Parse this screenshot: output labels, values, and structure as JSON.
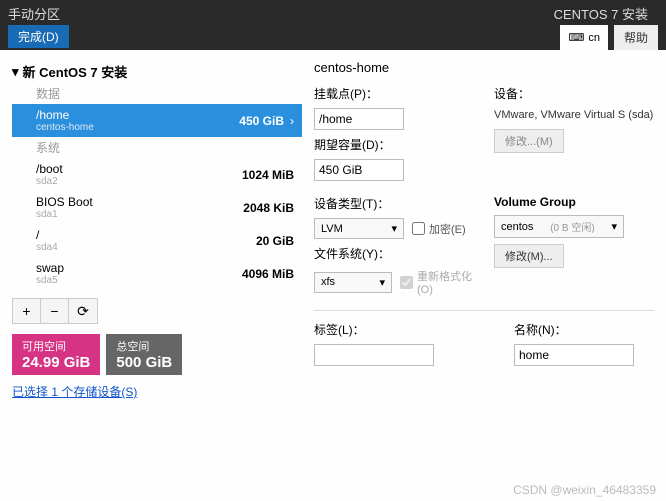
{
  "header": {
    "screen_title": "手动分区",
    "done_label": "完成(D)",
    "install_title": "CENTOS 7 安装",
    "lang_code": "cn",
    "help_label": "帮助"
  },
  "left": {
    "install_header": "新 CentOS 7 安装",
    "cat_data": "数据",
    "cat_system": "系统",
    "partitions": {
      "home": {
        "mount": "/home",
        "dev": "centos-home",
        "size": "450 GiB"
      },
      "boot": {
        "mount": "/boot",
        "dev": "sda2",
        "size": "1024 MiB"
      },
      "bios": {
        "mount": "BIOS Boot",
        "dev": "sda1",
        "size": "2048 KiB"
      },
      "root": {
        "mount": "/",
        "dev": "sda4",
        "size": "20 GiB"
      },
      "swap": {
        "mount": "swap",
        "dev": "sda5",
        "size": "4096 MiB"
      }
    },
    "toolbar": {
      "add": "+",
      "remove": "−",
      "reload": "⟳"
    },
    "space": {
      "avail_label": "可用空间",
      "avail_value": "24.99 GiB",
      "total_label": "总空间",
      "total_value": "500 GiB"
    },
    "storage_link": "已选择 1 个存储设备(S)"
  },
  "right": {
    "title": "centos-home",
    "labels": {
      "mount": "挂载点(P)：",
      "desired": "期望容量(D)：",
      "device": "设备：",
      "modify": "修改...(M)",
      "devtype": "设备类型(T)：",
      "encrypt": "加密(E)",
      "vg": "Volume Group",
      "vg_free": "(0 B 空闲)",
      "modify2": "修改(M)...",
      "fs": "文件系统(Y)：",
      "reformat": "重新格式化(O)",
      "label": "标签(L)：",
      "name": "名称(N)："
    },
    "values": {
      "mount": "/home",
      "desired": "450 GiB",
      "device": "VMware, VMware Virtual S (sda)",
      "devtype": "LVM",
      "vg": "centos",
      "fs": "xfs",
      "label": "",
      "name": "home"
    }
  },
  "watermark": "CSDN @weixin_46483359"
}
